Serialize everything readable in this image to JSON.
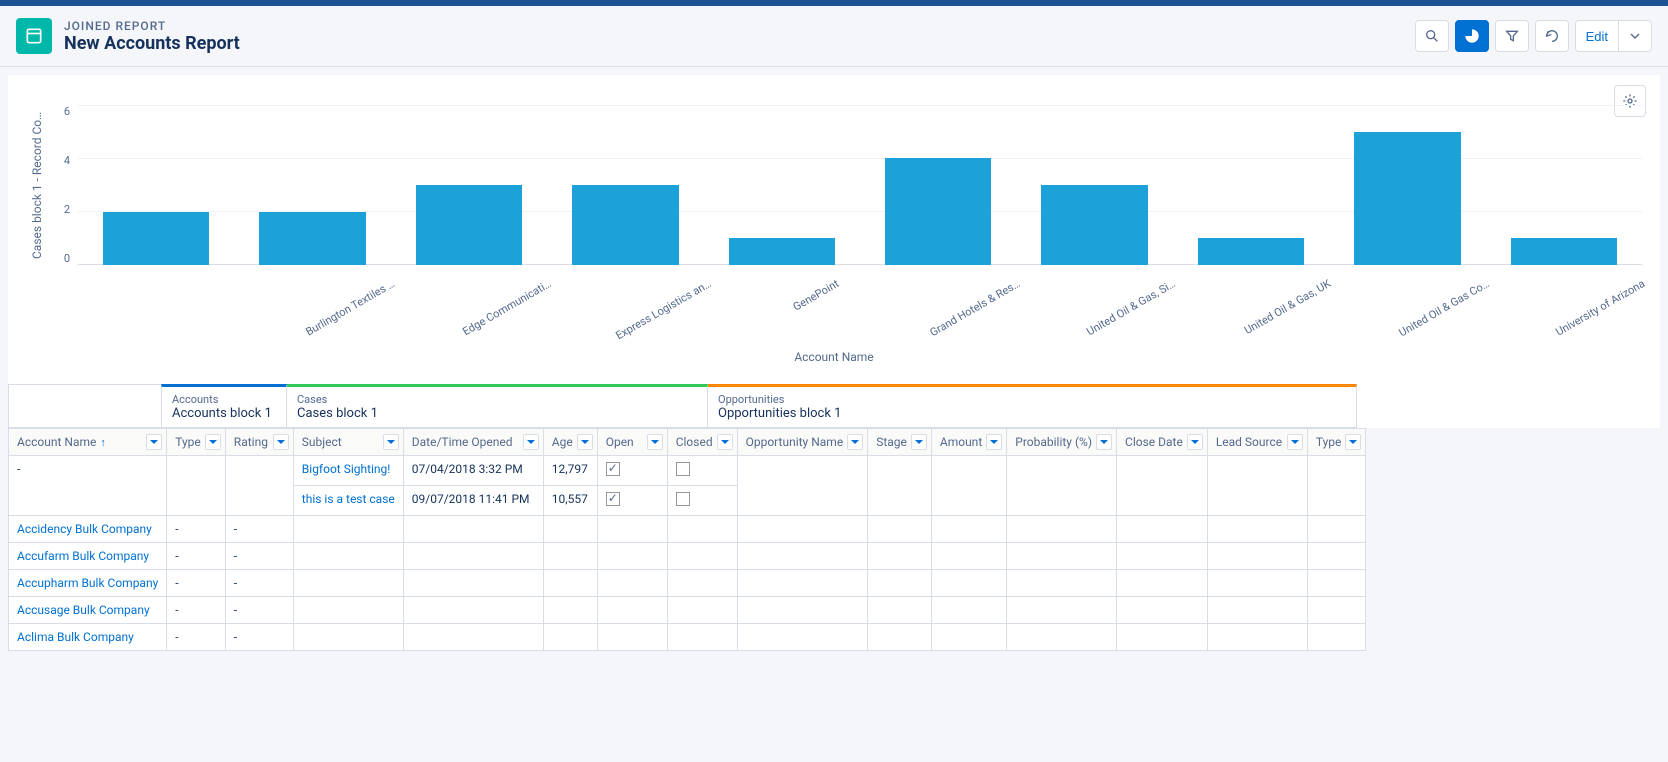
{
  "header": {
    "subtitle": "JOINED REPORT",
    "title": "New Accounts Report",
    "edit": "Edit"
  },
  "chart_data": {
    "type": "bar",
    "ylabel": "Cases block 1 - Record Co…",
    "xlabel": "Account Name",
    "ylim": [
      0,
      6
    ],
    "yticks": [
      0,
      2,
      4,
      6
    ],
    "categories": [
      "",
      "Burlington Textiles …",
      "Edge Communicati…",
      "Express Logistics an…",
      "GenePoint",
      "Grand Hotels & Res…",
      "United Oil & Gas, Si…",
      "United Oil & Gas, UK",
      "United Oil & Gas Co…",
      "University of Arizona"
    ],
    "values": [
      2,
      2,
      3,
      3,
      1,
      4,
      3,
      1,
      5,
      1
    ]
  },
  "blocks": {
    "accounts": {
      "type": "Accounts",
      "name": "Accounts block 1"
    },
    "cases": {
      "type": "Cases",
      "name": "Cases block 1"
    },
    "opportunities": {
      "type": "Opportunities",
      "name": "Opportunities block 1"
    }
  },
  "columns": {
    "account_name": "Account Name",
    "type": "Type",
    "rating": "Rating",
    "subject": "Subject",
    "date_opened": "Date/Time Opened",
    "age": "Age",
    "open": "Open",
    "closed": "Closed",
    "opportunity_name": "Opportunity Name",
    "stage": "Stage",
    "amount": "Amount",
    "probability": "Probability (%)",
    "close_date": "Close Date",
    "lead_source": "Lead Source",
    "type2": "Type"
  },
  "rows": [
    {
      "account": "-",
      "type": "",
      "rating": "",
      "cases": [
        {
          "subject": "Bigfoot Sighting!",
          "opened": "07/04/2018 3:32 PM",
          "age": "12,797",
          "open": true,
          "closed": false
        },
        {
          "subject": "this is a test case",
          "opened": "09/07/2018 11:41 PM",
          "age": "10,557",
          "open": true,
          "closed": false
        }
      ]
    },
    {
      "account": "Accidency Bulk Company",
      "type": "-",
      "rating": "-",
      "cases": []
    },
    {
      "account": "Accufarm Bulk Company",
      "type": "-",
      "rating": "-",
      "cases": []
    },
    {
      "account": "Accupharm Bulk Company",
      "type": "-",
      "rating": "-",
      "cases": []
    },
    {
      "account": "Accusage Bulk Company",
      "type": "-",
      "rating": "-",
      "cases": []
    },
    {
      "account": "Aclima Bulk Company",
      "type": "-",
      "rating": "-",
      "cases": []
    }
  ]
}
